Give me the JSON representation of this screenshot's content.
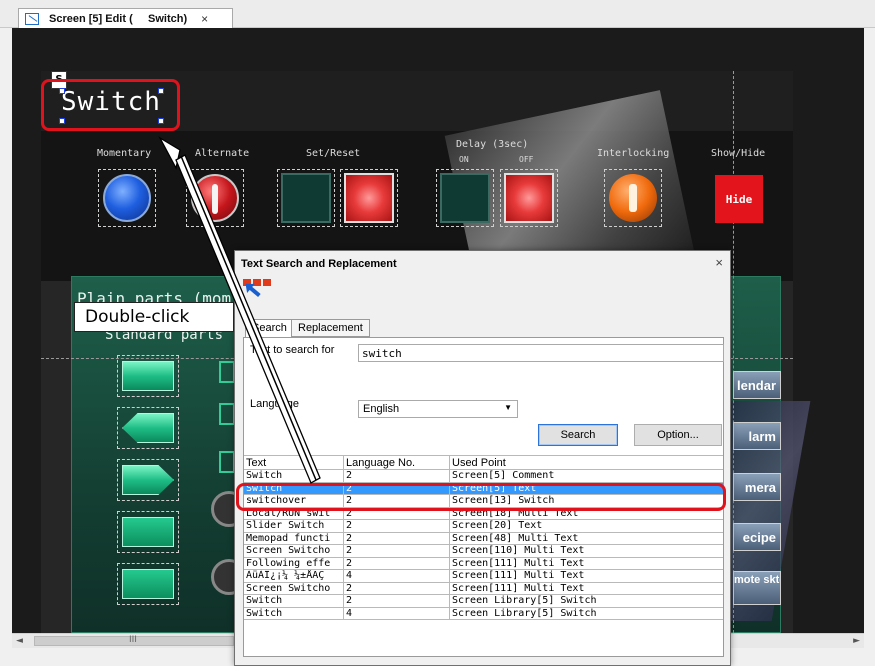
{
  "tab": {
    "title": "Screen [5] Edit (     Switch)",
    "close": "×"
  },
  "screen": {
    "title": "Switch",
    "sel_icon": "S",
    "labels": {
      "momentary": "Momentary",
      "alternate": "Alternate",
      "set_reset": "Set/Reset",
      "delay": "Delay (3sec)",
      "delay_on": "ON",
      "delay_off": "OFF",
      "interlocking": "Interlocking",
      "show_hide": "Show/Hide"
    },
    "hide_button": "Hide",
    "plain_parts": "Plain parts (mom",
    "standard_parts": "Standard parts",
    "side_buttons": [
      "lendar",
      "larm",
      "mera",
      "ecipe",
      "mote sktop"
    ]
  },
  "callout": "Double-click",
  "scrollbar": {
    "left": "◄",
    "right": "►",
    "grip": "III"
  },
  "dialog": {
    "title": "Text Search and Replacement",
    "close": "×",
    "tabs": {
      "search": "Search",
      "replacement": "Replacement"
    },
    "search_label": "Text to search for",
    "search_value": "switch",
    "language_label": "Language",
    "language_value": "English",
    "search_button": "Search",
    "option_button": "Option...",
    "columns": [
      "Text",
      "Language No.",
      "Used Point"
    ],
    "rows": [
      {
        "text": "Switch",
        "lang": "2",
        "used": "Screen[5] Comment"
      },
      {
        "text": "Switch",
        "lang": "2",
        "used": "Screen[5] Text"
      },
      {
        "text": "switchover",
        "lang": "2",
        "used": "Screen[13] Switch"
      },
      {
        "text": "Local/RUN swit",
        "lang": "2",
        "used": "Screen[18] Multi Text"
      },
      {
        "text": "Slider Switch",
        "lang": "2",
        "used": "Screen[20] Text"
      },
      {
        "text": "Memopad functi",
        "lang": "2",
        "used": "Screen[48] Multi Text"
      },
      {
        "text": "Screen Switcho",
        "lang": "2",
        "used": "Screen[110] Multi Text"
      },
      {
        "text": "Following effe",
        "lang": "2",
        "used": "Screen[111] Multi Text"
      },
      {
        "text": "ÀüÀÎ¿¡¼­ ¼±ÅÃÇ",
        "lang": "4",
        "used": "Screen[111] Multi Text"
      },
      {
        "text": "Screen Switcho",
        "lang": "2",
        "used": "Screen[111] Multi Text"
      },
      {
        "text": "Switch",
        "lang": "2",
        "used": "Screen Library[5] Switch"
      },
      {
        "text": "Switch",
        "lang": "4",
        "used": "Screen Library[5] Switch"
      }
    ],
    "selected_row": 1
  },
  "colors": {
    "highlight": "#e0131c",
    "selection": "#3399ff",
    "accent": "#1e6ec8"
  }
}
